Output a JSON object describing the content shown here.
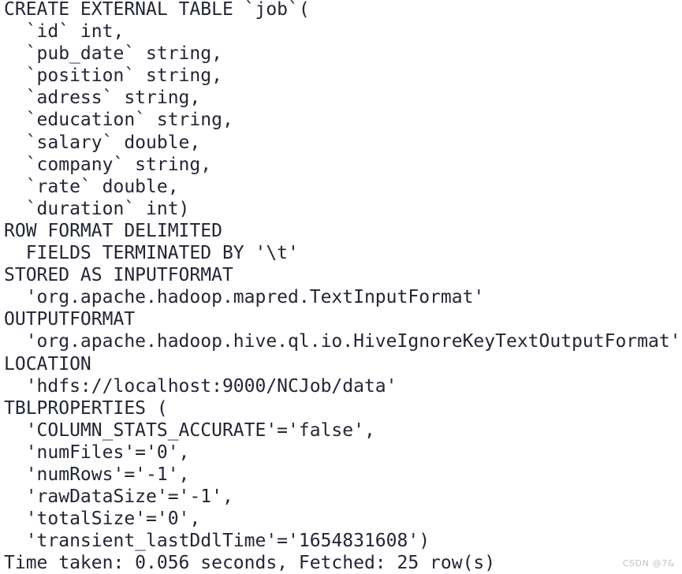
{
  "terminal": {
    "background_color": "#ffffff",
    "text_color": "#232634",
    "lines": [
      {
        "id": "line-1",
        "text": "CREATE EXTERNAL TABLE `job`("
      },
      {
        "id": "line-2",
        "text": "  `id` int,"
      },
      {
        "id": "line-3",
        "text": "  `pub_date` string,"
      },
      {
        "id": "line-4",
        "text": "  `position` string,"
      },
      {
        "id": "line-5",
        "text": "  `adress` string,"
      },
      {
        "id": "line-6",
        "text": "  `education` string,"
      },
      {
        "id": "line-7",
        "text": "  `salary` double,"
      },
      {
        "id": "line-8",
        "text": "  `company` string,"
      },
      {
        "id": "line-9",
        "text": "  `rate` double,"
      },
      {
        "id": "line-10",
        "text": "  `duration` int)"
      },
      {
        "id": "line-11",
        "text": "ROW FORMAT DELIMITED"
      },
      {
        "id": "line-12",
        "text": "  FIELDS TERMINATED BY '\\t'"
      },
      {
        "id": "line-13",
        "text": "STORED AS INPUTFORMAT"
      },
      {
        "id": "line-14",
        "text": "  'org.apache.hadoop.mapred.TextInputFormat'"
      },
      {
        "id": "line-15",
        "text": "OUTPUTFORMAT"
      },
      {
        "id": "line-16",
        "text": "  'org.apache.hadoop.hive.ql.io.HiveIgnoreKeyTextOutputFormat'"
      },
      {
        "id": "line-17",
        "text": "LOCATION"
      },
      {
        "id": "line-18",
        "text": "  'hdfs://localhost:9000/NCJob/data'"
      },
      {
        "id": "line-19",
        "text": "TBLPROPERTIES ("
      },
      {
        "id": "line-20",
        "text": "  'COLUMN_STATS_ACCURATE'='false',"
      },
      {
        "id": "line-21",
        "text": "  'numFiles'='0',"
      },
      {
        "id": "line-22",
        "text": "  'numRows'='-1',"
      },
      {
        "id": "line-23",
        "text": "  'rawDataSize'='-1',"
      },
      {
        "id": "line-24",
        "text": "  'totalSize'='0',"
      },
      {
        "id": "line-25",
        "text": "  'transient_lastDdlTime'='1654831608')"
      },
      {
        "id": "line-26",
        "text": "Time taken: 0.056 seconds, Fetched: 25 row(s)"
      }
    ]
  },
  "watermark": {
    "text": "CSDN @7&",
    "color": "#c2c2c6"
  }
}
